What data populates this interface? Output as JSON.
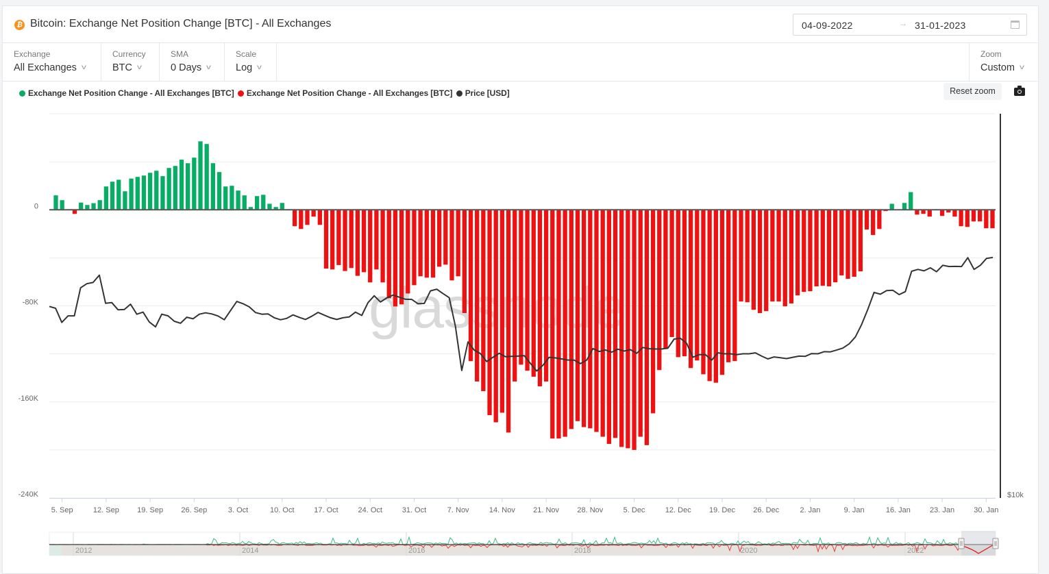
{
  "header": {
    "title": "Bitcoin: Exchange Net Position Change [BTC] - All Exchanges",
    "asset_icon": "bitcoin-icon",
    "date_from": "04-09-2022",
    "date_to": "31-01-2023",
    "date_arrow": "→",
    "calendar_icon": "calendar-icon"
  },
  "controls": [
    {
      "label": "Exchange",
      "value": "All Exchanges"
    },
    {
      "label": "Currency",
      "value": "BTC"
    },
    {
      "label": "SMA",
      "value": "0 Days"
    },
    {
      "label": "Scale",
      "value": "Log"
    }
  ],
  "zoom_control": {
    "label": "Zoom",
    "value": "Custom"
  },
  "toolbar": {
    "reset_zoom": "Reset zoom",
    "camera_icon": "camera-icon"
  },
  "watermark": "glassnode",
  "colors": {
    "positive": "#07ad64",
    "negative": "#ee1111",
    "price": "#333333",
    "bitcoin": "#f7931a"
  },
  "chart_data": {
    "type": "bar",
    "title": "Bitcoin: Exchange Net Position Change [BTC] - All Exchanges",
    "date_range": [
      "2022-09-04",
      "2023-01-31"
    ],
    "legend": [
      {
        "label": "Exchange Net Position Change - All Exchanges [BTC]",
        "color": "#07ad64"
      },
      {
        "label": "Exchange Net Position Change - All Exchanges [BTC]",
        "color": "#ee1111"
      },
      {
        "label": "Price [USD]",
        "color": "#333333"
      }
    ],
    "legend_position": "top-left",
    "y_left": {
      "ticks": [
        0,
        -80000,
        -160000,
        -240000
      ],
      "tick_labels": [
        "0",
        "-80K",
        "-160K",
        "-240K"
      ],
      "range": [
        80000,
        -240000
      ],
      "grid_step": 40000
    },
    "y_right": {
      "scale": "log",
      "tick_labels": [
        "$10k"
      ],
      "tick_values": [
        10000
      ]
    },
    "x_tick_labels": [
      "5. Sep",
      "12. Sep",
      "19. Sep",
      "26. Sep",
      "3. Oct",
      "10. Oct",
      "17. Oct",
      "24. Oct",
      "31. Oct",
      "7. Nov",
      "14. Nov",
      "21. Nov",
      "28. Nov",
      "5. Dec",
      "12. Dec",
      "19. Dec",
      "26. Dec",
      "2. Jan",
      "9. Jan",
      "16. Jan",
      "23. Jan",
      "30. Jan"
    ],
    "net_position_change_btc": [
      12000,
      8000,
      300,
      -3400,
      6000,
      4000,
      5500,
      8000,
      19400,
      23400,
      25000,
      15400,
      26000,
      27400,
      28500,
      30800,
      32500,
      28000,
      34800,
      36500,
      41700,
      38800,
      43400,
      57000,
      54800,
      38800,
      31400,
      19400,
      20000,
      16000,
      12000,
      2300,
      11400,
      12500,
      5000,
      2300,
      5700,
      500,
      -13700,
      -16000,
      -12600,
      -5700,
      -12600,
      -49000,
      -49700,
      -46000,
      -51000,
      -48500,
      -55000,
      -52000,
      -60500,
      -49700,
      -60500,
      -73700,
      -80500,
      -78800,
      -69700,
      -62800,
      -55400,
      -56500,
      -56500,
      -47400,
      -45700,
      -58800,
      -55400,
      -86000,
      -126000,
      -143000,
      -151000,
      -171000,
      -177000,
      -169000,
      -185500,
      -143000,
      -129000,
      -134000,
      -139000,
      -147000,
      -143000,
      -190500,
      -190500,
      -189000,
      -182600,
      -176000,
      -181000,
      -182000,
      -185000,
      -189000,
      -195000,
      -190000,
      -197500,
      -198600,
      -200000,
      -189000,
      -196000,
      -169500,
      -133500,
      -116000,
      -106000,
      -122700,
      -122000,
      -131800,
      -125500,
      -137000,
      -142700,
      -144000,
      -137500,
      -127000,
      -126000,
      -76400,
      -77000,
      -83300,
      -86000,
      -84400,
      -76400,
      -76400,
      -80400,
      -78000,
      -71300,
      -68400,
      -67800,
      -63800,
      -63300,
      -63800,
      -60400,
      -54700,
      -57500,
      -55800,
      -51300,
      -16400,
      -21000,
      -16000,
      -1100,
      5000,
      400,
      5700,
      14700,
      -4000,
      -3400,
      -5700,
      500,
      -5100,
      -2300,
      -5700,
      -13700,
      -14300,
      -9700,
      -9700,
      -15400,
      -15400
    ],
    "price_usd": [
      20140,
      20010,
      18980,
      19450,
      19450,
      21590,
      21920,
      22020,
      22630,
      20380,
      20430,
      19890,
      19910,
      20310,
      19570,
      19720,
      19010,
      18670,
      19570,
      19450,
      19060,
      18920,
      19350,
      19240,
      19570,
      19670,
      19590,
      19440,
      19170,
      19840,
      20520,
      20350,
      20110,
      19690,
      19570,
      19590,
      19310,
      19170,
      19270,
      19520,
      19340,
      19190,
      19420,
      19700,
      19500,
      19310,
      19190,
      19310,
      19370,
      19720,
      19480,
      20430,
      20960,
      20480,
      20790,
      21010,
      20850,
      20690,
      20680,
      20350,
      20370,
      21350,
      21480,
      21130,
      20810,
      18700,
      15870,
      17650,
      17120,
      16900,
      16410,
      16670,
      16920,
      16710,
      16730,
      16740,
      16770,
      16290,
      15840,
      16180,
      16670,
      16630,
      16570,
      16500,
      16490,
      16280,
      16490,
      17220,
      17030,
      17130,
      16990,
      17180,
      17060,
      17150,
      16920,
      17290,
      17210,
      17190,
      17190,
      17250,
      17840,
      17890,
      17550,
      16670,
      16830,
      16830,
      16490,
      16950,
      16890,
      16890,
      16830,
      16890,
      16890,
      16950,
      16740,
      16570,
      16690,
      16640,
      16590,
      16670,
      16740,
      16730,
      16900,
      16890,
      17020,
      17010,
      17120,
      17250,
      17520,
      17980,
      18830,
      19930,
      21220,
      21080,
      21370,
      21390,
      21050,
      21280,
      22960,
      23120,
      23000,
      23260,
      22920,
      23480,
      23370,
      23380,
      23370,
      24150,
      23120,
      23480,
      24090,
      24170
    ]
  },
  "navigator": {
    "year_labels": [
      "2012",
      "2014",
      "2016",
      "2018",
      "2020",
      "2022"
    ],
    "selected_range": [
      "04-09-2022",
      "31-01-2023"
    ]
  }
}
